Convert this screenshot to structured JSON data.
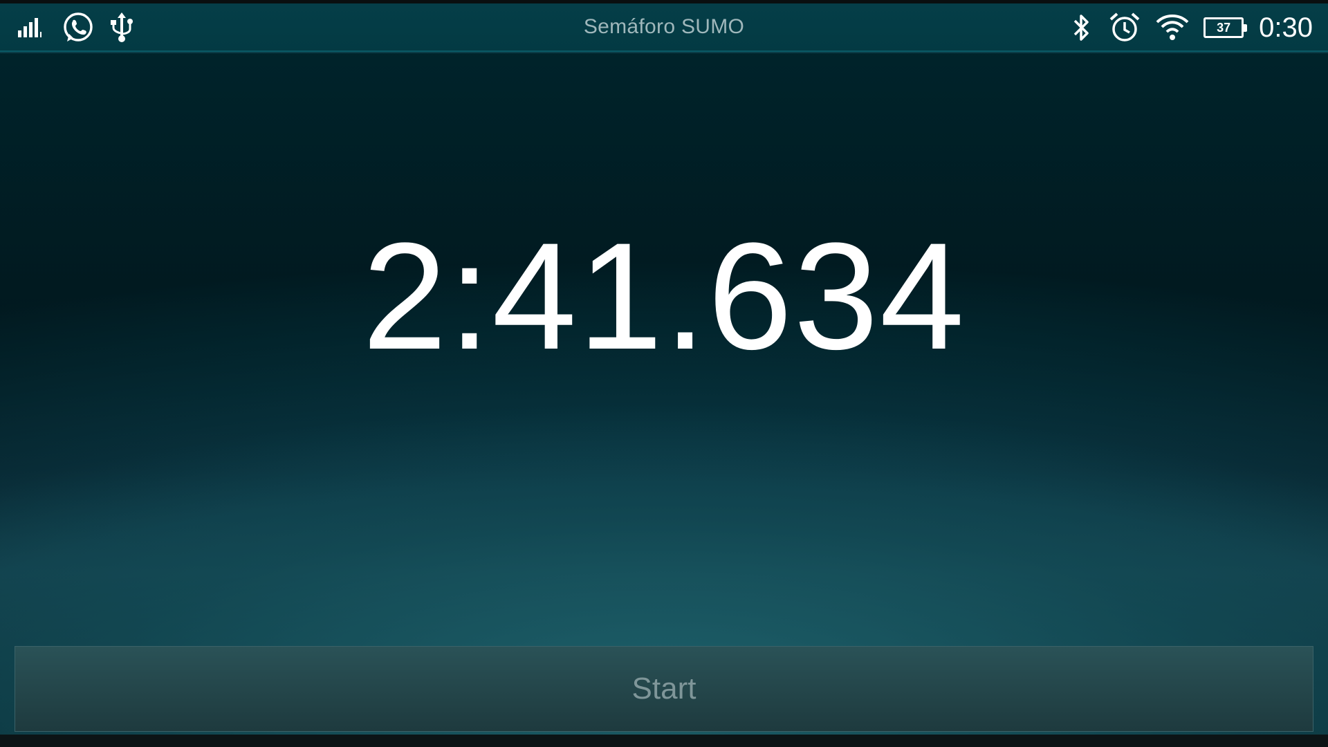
{
  "status_bar": {
    "title": "Semáforo SUMO",
    "clock": "0:30",
    "battery_level": "37",
    "left_icons": [
      "signal-icon",
      "whatsapp-icon",
      "usb-icon"
    ],
    "right_icons": [
      "bluetooth-icon",
      "alarm-icon",
      "wifi-icon",
      "battery-icon"
    ]
  },
  "main": {
    "timer": "2:41.634"
  },
  "actions": {
    "start_label": "Start"
  },
  "colors": {
    "background_top": "#006f80",
    "background_mid": "#063e4a",
    "text": "#ffffff",
    "button_text": "#7f9699"
  }
}
